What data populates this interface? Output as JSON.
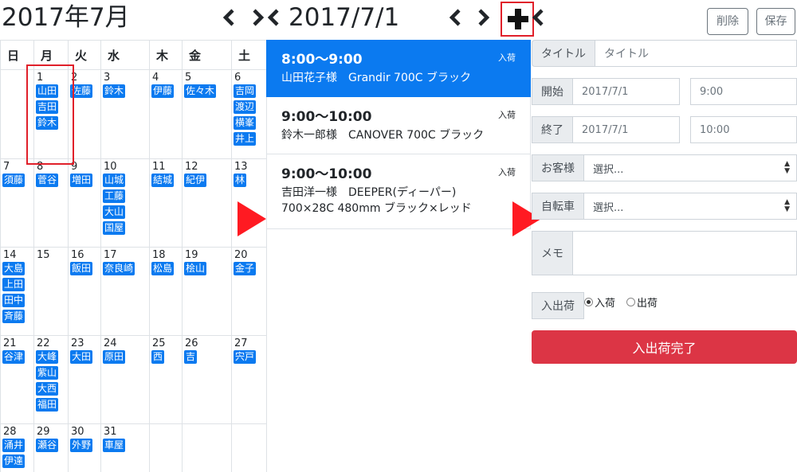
{
  "header": {
    "month_title": "2017年7月",
    "day_title": "2017/7/1",
    "delete_label": "削除",
    "save_label": "保存"
  },
  "calendar": {
    "weekdays": [
      "日",
      "月",
      "火",
      "水",
      "木",
      "金",
      "土"
    ],
    "weeks": [
      [
        {
          "day": "",
          "tags": []
        },
        {
          "day": "1",
          "tags": [
            "山田",
            "吉田",
            "鈴木"
          ]
        },
        {
          "day": "2",
          "tags": [
            "佐藤"
          ]
        },
        {
          "day": "3",
          "tags": [
            "鈴木"
          ]
        },
        {
          "day": "4",
          "tags": [
            "伊藤"
          ]
        },
        {
          "day": "5",
          "tags": [
            "佐々木"
          ]
        },
        {
          "day": "6",
          "tags": [
            "吉岡",
            "渡辺",
            "横峯",
            "井上"
          ]
        }
      ],
      [
        {
          "day": "7",
          "tags": [
            "須藤"
          ]
        },
        {
          "day": "8",
          "tags": [
            "菅谷"
          ]
        },
        {
          "day": "9",
          "tags": [
            "増田"
          ]
        },
        {
          "day": "10",
          "tags": [
            "山城",
            "工藤",
            "大山",
            "国屋"
          ]
        },
        {
          "day": "11",
          "tags": [
            "結城"
          ]
        },
        {
          "day": "12",
          "tags": [
            "紀伊"
          ]
        },
        {
          "day": "13",
          "tags": [
            "林"
          ]
        }
      ],
      [
        {
          "day": "14",
          "tags": [
            "大島",
            "上田",
            "田中",
            "斉藤"
          ]
        },
        {
          "day": "15",
          "tags": []
        },
        {
          "day": "16",
          "tags": [
            "飯田"
          ]
        },
        {
          "day": "17",
          "tags": [
            "奈良崎"
          ]
        },
        {
          "day": "18",
          "tags": [
            "松島"
          ]
        },
        {
          "day": "19",
          "tags": [
            "桧山"
          ]
        },
        {
          "day": "20",
          "tags": [
            "金子"
          ]
        }
      ],
      [
        {
          "day": "21",
          "tags": [
            "谷津"
          ]
        },
        {
          "day": "22",
          "tags": [
            "大峰",
            "紫山",
            "大西",
            "福田"
          ]
        },
        {
          "day": "23",
          "tags": [
            "大田"
          ]
        },
        {
          "day": "24",
          "tags": [
            "原田"
          ]
        },
        {
          "day": "25",
          "tags": [
            "西"
          ]
        },
        {
          "day": "26",
          "tags": [
            "吉"
          ]
        },
        {
          "day": "27",
          "tags": [
            "宍戸"
          ]
        }
      ],
      [
        {
          "day": "28",
          "tags": [
            "涌井",
            "伊達"
          ]
        },
        {
          "day": "29",
          "tags": [
            "瀬谷"
          ]
        },
        {
          "day": "30",
          "tags": [
            "外野"
          ]
        },
        {
          "day": "31",
          "tags": [
            "車屋"
          ]
        },
        {
          "day": "",
          "tags": []
        },
        {
          "day": "",
          "tags": []
        },
        {
          "day": "",
          "tags": []
        }
      ]
    ]
  },
  "events": [
    {
      "time": "8:00〜9:00",
      "desc": "山田花子様　Grandir 700C ブラック",
      "badge": "入荷"
    },
    {
      "time": "9:00〜10:00",
      "desc": "鈴木一郎様　CANOVER 700C ブラック",
      "badge": "入荷"
    },
    {
      "time": "9:00〜10:00",
      "desc": "吉田洋一様　DEEPER(ディーパー) 700×28C 480mm ブラック×レッド",
      "badge": "入荷"
    }
  ],
  "form": {
    "title_label": "タイトル",
    "title_placeholder": "タイトル",
    "start_label": "開始",
    "start_date": "2017/7/1",
    "start_time": "9:00",
    "end_label": "終了",
    "end_date": "2017/7/1",
    "end_time": "10:00",
    "customer_label": "お客様",
    "customer_value": "選択...",
    "bike_label": "自転車",
    "bike_value": "選択...",
    "memo_label": "メモ",
    "inout_label": "入出荷",
    "radio_in": "入荷",
    "radio_out": "出荷",
    "submit_label": "入出荷完了"
  },
  "colors": {
    "accent": "#0b7af0",
    "danger": "#dc3545",
    "highlight": "#e0202a",
    "arrow": "#ff1a22"
  },
  "icons": [
    "chevron-left-icon",
    "collapse-icon",
    "chevron-left-icon",
    "chevron-right-icon",
    "plus-icon",
    "chevron-left-icon"
  ]
}
